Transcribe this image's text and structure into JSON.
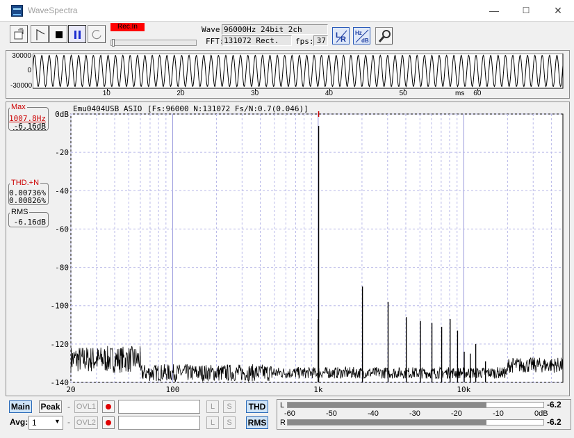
{
  "window": {
    "title": "WaveSpectra",
    "minimize": "—",
    "maximize": "☐",
    "close": "✕"
  },
  "toolbar": {
    "rec_indicator": "Rec.In",
    "wave_label": "Wave:",
    "wave_value": "96000Hz 24bit 2ch",
    "fft_label": "FFT:",
    "fft_value": "131072 Rect.",
    "fps_label": "fps:",
    "fps_value": "37",
    "buttons": [
      "open-file-icon",
      "play-start-icon",
      "stop-icon",
      "pause-icon",
      "refresh-icon",
      "lr-channel-icon",
      "hz-db-icon",
      "settings-wrench-icon"
    ]
  },
  "waveform": {
    "y_ticks": [
      "30000",
      "0",
      "-30000"
    ],
    "x_ticks": [
      "10",
      "20",
      "30",
      "40",
      "50",
      "60"
    ],
    "x_unit": "ms",
    "frequency_hz": 1007.8,
    "duration_ms": 71.5,
    "amplitude_norm": 0.45
  },
  "spectrum": {
    "device_label": "Emu0404USB ASIO",
    "params_label": "[Fs:96000 N:131072 Fs/N:0.7(0.046)]",
    "max_title": "Max",
    "max_freq": "1007.8Hz",
    "max_db": "-6.16dB",
    "thd_title": "THD.+N",
    "thd_l": "0.00736%",
    "thd_r": "0.00826%",
    "rms_title": "RMS",
    "rms_value": "-6.16dB"
  },
  "chart_data": {
    "type": "line",
    "xscale": "log",
    "xlim": [
      20,
      48000
    ],
    "ylim": [
      -140,
      0
    ],
    "y_ticks": [
      {
        "v": 0,
        "label": "0dB"
      },
      {
        "v": -20,
        "label": "-20"
      },
      {
        "v": -40,
        "label": "-40"
      },
      {
        "v": -60,
        "label": "-60"
      },
      {
        "v": -80,
        "label": "-80"
      },
      {
        "v": -100,
        "label": "-100"
      },
      {
        "v": -120,
        "label": "-120"
      },
      {
        "v": -140,
        "label": "-140"
      }
    ],
    "x_ticks": [
      {
        "v": 20,
        "label": "20"
      },
      {
        "v": 100,
        "label": "100"
      },
      {
        "v": 1000,
        "label": "1k"
      },
      {
        "v": 10000,
        "label": "10k"
      }
    ],
    "peaks": [
      {
        "f": 1007.8,
        "db": -6.16
      },
      {
        "f": 1000,
        "db": -107
      },
      {
        "f": 2015,
        "db": -90
      },
      {
        "f": 3023,
        "db": -98
      },
      {
        "f": 4031,
        "db": -106
      },
      {
        "f": 5039,
        "db": -108
      },
      {
        "f": 6047,
        "db": -109
      },
      {
        "f": 7055,
        "db": -111
      },
      {
        "f": 8063,
        "db": -107
      },
      {
        "f": 9071,
        "db": -113
      },
      {
        "f": 10078,
        "db": -124
      },
      {
        "f": 11086,
        "db": -125
      },
      {
        "f": 12094,
        "db": -120
      },
      {
        "f": 14110,
        "db": -129
      }
    ],
    "marker_freq": 1007.8
  },
  "bottom": {
    "main_label": "Main",
    "peak_label": "Peak",
    "ovl1_label": "OVL1",
    "ovl2_label": "OVL2",
    "l_label": "L",
    "s_label": "S",
    "avg_label": "Avg:",
    "avg_value": "1",
    "dash": "-",
    "thd_label": "THD",
    "rms_label": "RMS"
  },
  "meter": {
    "l_label": "L",
    "r_label": "R",
    "scale": [
      "-60",
      "-50",
      "-40",
      "-30",
      "-20",
      "-10",
      "0dB"
    ],
    "l_value": "-6.2",
    "r_value": "-6.2",
    "l_level_db": -6.2,
    "r_level_db": -6.2
  }
}
